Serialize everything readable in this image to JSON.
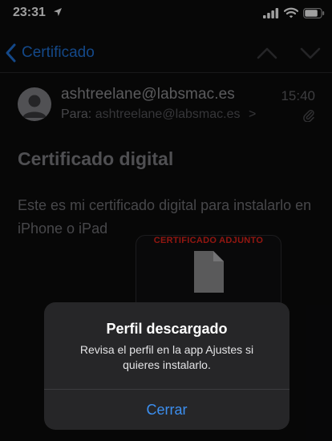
{
  "status_bar": {
    "time": "23:31",
    "icons": [
      "location-arrow-icon",
      "signal-icon",
      "wifi-icon",
      "battery-icon"
    ]
  },
  "navbar": {
    "back_label": "Certificado",
    "icons": [
      "back-chevron-icon",
      "chevron-up-icon",
      "chevron-down-icon"
    ]
  },
  "message": {
    "sender": "ashtreelane@labsmac.es",
    "time": "15:40",
    "to_prefix": "Para:",
    "to_address": "ashtreelane@labsmac.es",
    "to_chevron": ">",
    "subject": "Certificado digital",
    "body": "Este es mi certificado digital para instalarlo en iPhone o iPad",
    "attachment_label": "CERTIFICADO ADJUNTO"
  },
  "alert": {
    "title": "Perfil descargado",
    "message": "Revisa el perfil en la app Ajustes si quieres instalarlo.",
    "button_label": "Cerrar"
  },
  "colors": {
    "accent": "#1f6fd1",
    "alert_button": "#3c8ff0",
    "attachment_label": "#e0231a",
    "alert_background": "#262628"
  }
}
